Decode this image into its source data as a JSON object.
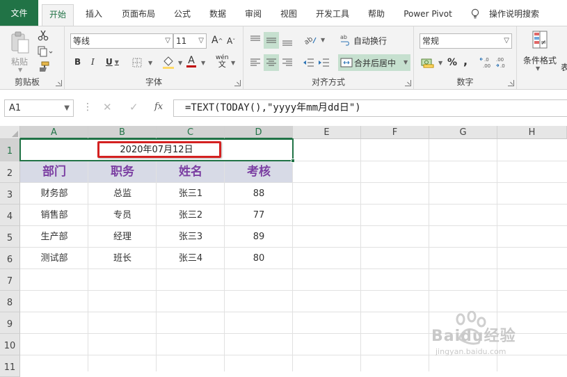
{
  "ribbon_tabs": [
    "文件",
    "开始",
    "插入",
    "页面布局",
    "公式",
    "数据",
    "审阅",
    "视图",
    "开发工具",
    "帮助",
    "Power Pivot",
    "操作说明搜索"
  ],
  "active_tab": "开始",
  "clipboard": {
    "paste_label": "粘贴",
    "group_label": "剪贴板"
  },
  "font": {
    "name": "等线",
    "size": "11",
    "bold": "B",
    "italic": "I",
    "underline": "U",
    "grow": "A",
    "shrink": "A",
    "color_letter": "A",
    "phonetic": "wén",
    "group_label": "字体"
  },
  "alignment": {
    "wrap_text": "自动换行",
    "merge_center": "合并后居中",
    "group_label": "对齐方式"
  },
  "number": {
    "format": "常规",
    "percent": "%",
    "comma": ",",
    "inc_decimal": "←.0 .00",
    "dec_decimal": ".00 →.0",
    "group_label": "数字"
  },
  "styles": {
    "conditional_format": "条件格式",
    "table_partial": "表"
  },
  "formula_bar": {
    "name_box": "A1",
    "cancel": "✕",
    "enter": "✓",
    "fx": "fx",
    "formula": "=TEXT(TODAY(),\"yyyy年mm月dd日\")"
  },
  "columns": [
    "A",
    "B",
    "C",
    "D",
    "E",
    "F",
    "G",
    "H"
  ],
  "rows": [
    "1",
    "2",
    "3",
    "4",
    "5",
    "6",
    "7",
    "8",
    "9",
    "10",
    "11"
  ],
  "sheet": {
    "a1_value": "2020年07月12日",
    "headers": [
      "部门",
      "职务",
      "姓名",
      "考核"
    ],
    "data": [
      [
        "财务部",
        "总监",
        "张三1",
        "88"
      ],
      [
        "销售部",
        "专员",
        "张三2",
        "77"
      ],
      [
        "生产部",
        "经理",
        "张三3",
        "89"
      ],
      [
        "测试部",
        "班长",
        "张三4",
        "80"
      ]
    ]
  },
  "watermark": {
    "brand": "Baidu经验",
    "url": "jingyan.baidu.com"
  },
  "colors": {
    "accent": "#217346",
    "header_text": "#7b3fa2",
    "header_band": "#d7dae6",
    "highlight": "#d42121"
  }
}
